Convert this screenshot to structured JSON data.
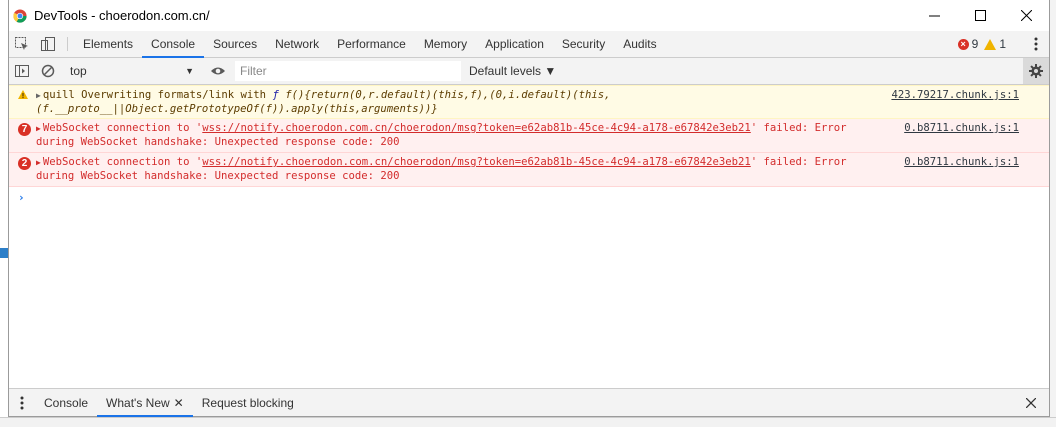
{
  "window": {
    "title": "DevTools - choerodon.com.cn/",
    "controls": {
      "minimize": "—",
      "maximize": "☐",
      "close": "✕"
    }
  },
  "tabs": [
    {
      "label": "Elements",
      "active": false
    },
    {
      "label": "Console",
      "active": true
    },
    {
      "label": "Sources",
      "active": false
    },
    {
      "label": "Network",
      "active": false
    },
    {
      "label": "Performance",
      "active": false
    },
    {
      "label": "Memory",
      "active": false
    },
    {
      "label": "Application",
      "active": false
    },
    {
      "label": "Security",
      "active": false
    },
    {
      "label": "Audits",
      "active": false
    }
  ],
  "counters": {
    "errors": "9",
    "warnings": "1"
  },
  "toolbar": {
    "context": "top",
    "filter_placeholder": "Filter",
    "levels": "Default levels ▼"
  },
  "messages": [
    {
      "level": "warning",
      "line1": {
        "prefix": "quill Overwriting formats/link with ",
        "fn": "ƒ",
        "body": " f(){return(0,r.default)(this,f),(0,i.default)(this,"
      },
      "line2": "(f.__proto__||Object.getPrototypeOf(f)).apply(this,arguments))}",
      "source": "423.79217.chunk.js:1"
    },
    {
      "level": "error",
      "count": "7",
      "pre": "WebSocket connection to '",
      "url": "wss://notify.choerodon.com.cn/choerodon/msg?token=e62ab81b-45ce-4c94-a178-e67842e3eb21",
      "post": "' failed: Error",
      "line2": "during WebSocket handshake: Unexpected response code: 200",
      "source": "0.b8711.chunk.js:1"
    },
    {
      "level": "error",
      "count": "2",
      "pre": "WebSocket connection to '",
      "url": "wss://notify.choerodon.com.cn/choerodon/msg?token=e62ab81b-45ce-4c94-a178-e67842e3eb21",
      "post": "' failed: Error",
      "line2": "during WebSocket handshake: Unexpected response code: 200",
      "source": "0.b8711.chunk.js:1"
    }
  ],
  "prompt_symbol": "›",
  "drawer": {
    "tabs": [
      {
        "label": "Console"
      },
      {
        "label": "What's New",
        "active": true,
        "closable": true
      },
      {
        "label": "Request blocking"
      }
    ]
  },
  "colors": {
    "accent": "#1a73e8",
    "error": "#d93025",
    "warning": "#f0b400",
    "error_bg": "#fff0f0",
    "warning_bg": "#fffbe5"
  }
}
